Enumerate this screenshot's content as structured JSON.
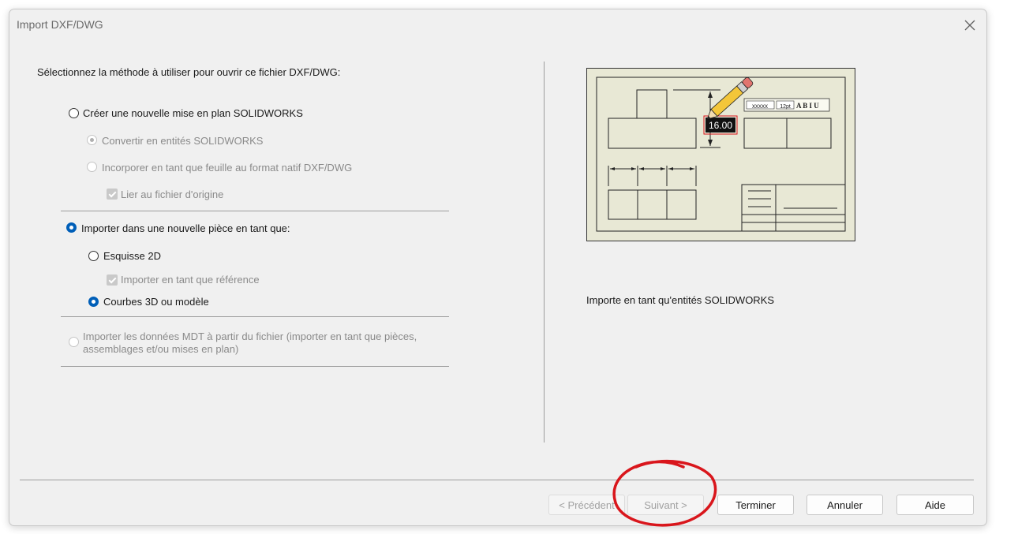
{
  "window": {
    "title": "Import DXF/DWG"
  },
  "prompt": "Sélectionnez la méthode à utiliser pour ouvrir ce fichier DXF/DWG:",
  "options": {
    "new_drawing": {
      "label": "Créer une nouvelle mise en plan SOLIDWORKS",
      "checked": false
    },
    "convert": {
      "label": "Convertir en entités SOLIDWORKS",
      "checked": true,
      "enabled": false
    },
    "embed": {
      "label": "Incorporer en tant que feuille au format natif DXF/DWG",
      "checked": false,
      "enabled": false
    },
    "link": {
      "label": "Lier au fichier d'origine",
      "checked": true,
      "enabled": false
    },
    "new_part": {
      "label": "Importer dans une nouvelle pièce en tant que:",
      "checked": true
    },
    "sketch2d": {
      "label": "Esquisse 2D",
      "checked": false
    },
    "as_reference": {
      "label": "Importer en tant que référence",
      "checked": true,
      "enabled": false
    },
    "curves3d": {
      "label": "Courbes 3D ou modèle",
      "checked": true
    },
    "mdt_line1": "Importer les données MDT à partir du fichier (importer en tant que pièces,",
    "mdt_line2": "assemblages et/ou mises en plan)"
  },
  "preview": {
    "dimension": "16.00",
    "toolbar_text": "xxxxx",
    "toolbar_size": "12pt",
    "toolbar_styles": "A B I U",
    "description": "Importe en tant qu'entités SOLIDWORKS"
  },
  "buttons": {
    "back": "< Précédent",
    "next": "Suivant >",
    "finish": "Terminer",
    "cancel": "Annuler",
    "help": "Aide"
  },
  "colors": {
    "accent": "#005fb8",
    "annotation": "#d9161c",
    "preview_bg": "#e8e8d5"
  }
}
